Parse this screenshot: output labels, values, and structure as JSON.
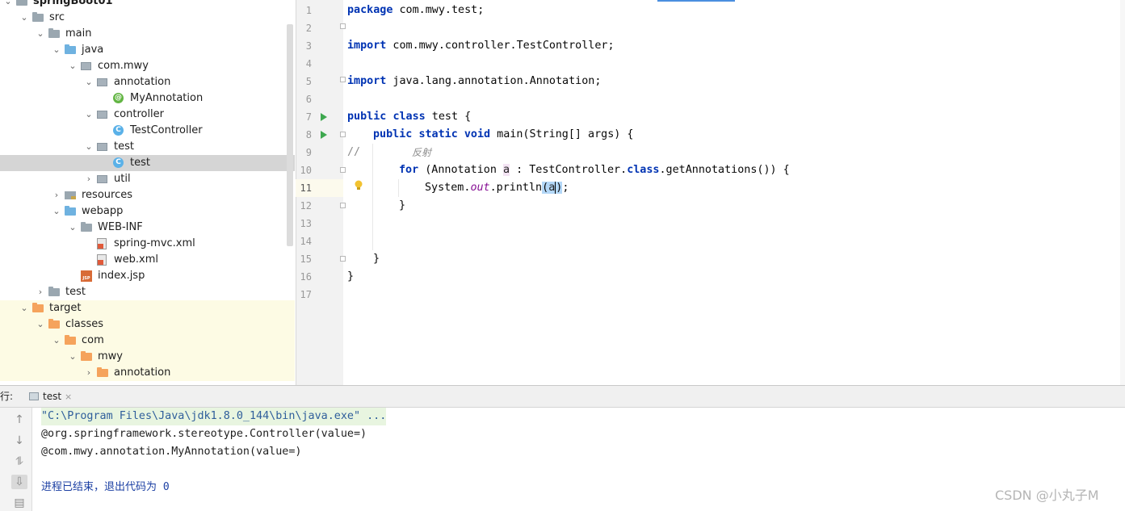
{
  "project_tree": {
    "items": [
      {
        "label": "springBoot01",
        "depth": 0,
        "icon": "module-icon",
        "expanded": true
      },
      {
        "label": "src",
        "depth": 1,
        "icon": "folder-icon",
        "expanded": true
      },
      {
        "label": "main",
        "depth": 2,
        "icon": "folder-icon",
        "expanded": true
      },
      {
        "label": "java",
        "depth": 3,
        "icon": "source-folder-icon",
        "expanded": true
      },
      {
        "label": "com.mwy",
        "depth": 4,
        "icon": "package-icon",
        "expanded": true
      },
      {
        "label": "annotation",
        "depth": 5,
        "icon": "package-icon",
        "expanded": true
      },
      {
        "label": "MyAnnotation",
        "depth": 6,
        "icon": "annotation-icon"
      },
      {
        "label": "controller",
        "depth": 5,
        "icon": "package-icon",
        "expanded": true
      },
      {
        "label": "TestController",
        "depth": 6,
        "icon": "class-icon"
      },
      {
        "label": "test",
        "depth": 5,
        "icon": "package-icon",
        "expanded": true
      },
      {
        "label": "test",
        "depth": 6,
        "icon": "class-icon",
        "selected": true
      },
      {
        "label": "util",
        "depth": 5,
        "icon": "package-icon",
        "expanded": false
      },
      {
        "label": "resources",
        "depth": 3,
        "icon": "resources-folder-icon",
        "expanded": false
      },
      {
        "label": "webapp",
        "depth": 3,
        "icon": "web-folder-icon",
        "expanded": true
      },
      {
        "label": "WEB-INF",
        "depth": 4,
        "icon": "folder-icon",
        "expanded": true
      },
      {
        "label": "spring-mvc.xml",
        "depth": 5,
        "icon": "xml-file-icon"
      },
      {
        "label": "web.xml",
        "depth": 5,
        "icon": "xml-file-icon"
      },
      {
        "label": "index.jsp",
        "depth": 4,
        "icon": "jsp-file-icon"
      },
      {
        "label": "test",
        "depth": 2,
        "icon": "folder-icon",
        "expanded": false
      },
      {
        "label": "target",
        "depth": 1,
        "icon": "excluded-folder-icon",
        "expanded": true,
        "excluded": true
      },
      {
        "label": "classes",
        "depth": 2,
        "icon": "excluded-folder-icon",
        "expanded": true,
        "excluded": true
      },
      {
        "label": "com",
        "depth": 3,
        "icon": "excluded-folder-icon",
        "expanded": true,
        "excluded": true
      },
      {
        "label": "mwy",
        "depth": 4,
        "icon": "excluded-folder-icon",
        "expanded": true,
        "excluded": true
      },
      {
        "label": "annotation",
        "depth": 5,
        "icon": "excluded-folder-icon",
        "expanded": false,
        "excluded": true
      }
    ]
  },
  "editor": {
    "line_numbers": [
      "1",
      "2",
      "3",
      "4",
      "5",
      "6",
      "7",
      "8",
      "9",
      "10",
      "11",
      "12",
      "13",
      "14",
      "15",
      "16",
      "17"
    ],
    "current_line": "11",
    "lines": {
      "l1": [
        "package com.mwy.test;"
      ],
      "l3": [
        "import com.mwy.controller.TestController;"
      ],
      "l5": [
        "import java.lang.annotation.Annotation;"
      ],
      "l7": [
        "public class test {"
      ],
      "l8": [
        "public static void main(String[] args) {"
      ],
      "l9": [
        "//",
        "反射"
      ],
      "l10": [
        "for (Annotation a : TestController.class.getAnnotations()) {"
      ],
      "l11": [
        "System.out.println(a);"
      ],
      "l12": [
        "}"
      ],
      "l15": [
        "}"
      ],
      "l16": [
        "}"
      ]
    },
    "tokens": {
      "l1_kw": "package",
      "l1_rest": " com.mwy.test;",
      "l3_kw": "import",
      "l3_rest": " com.mwy.controller.TestController;",
      "l5_kw": "import",
      "l5_rest": " java.lang.annotation.Annotation;",
      "l7_kw1": "public",
      "l7_kw2": "class",
      "l7_rest": " test {",
      "l8_kw1": "public",
      "l8_kw2": "static",
      "l8_kw3": "void",
      "l8_rest": " main(String[] args) {",
      "l9_slash": "//",
      "l9_text": "反射",
      "l10_kw": "for",
      "l10_a": " (Annotation ",
      "l10_var": "a",
      "l10_b": " : TestController.",
      "l10_kw2": "class",
      "l10_c": ".getAnnotations()) {",
      "l11_a": "System.",
      "l11_fld": "out",
      "l11_b": ".println",
      "l11_p1": "(",
      "l11_var": "a",
      "l11_p2": ")",
      "l11_end": ";",
      "l12": "}",
      "l15": "}",
      "l16": "}"
    }
  },
  "run_panel": {
    "label": "行:",
    "tab_label": "test",
    "tab_close": "×",
    "toolbar": [
      "up-arrow-icon",
      "down-arrow-icon",
      "soft-wrap-icon",
      "scroll-to-end-icon",
      "print-icon"
    ],
    "output": [
      "\"C:\\Program Files\\Java\\jdk1.8.0_144\\bin\\java.exe\" ...",
      "@org.springframework.stereotype.Controller(value=)",
      "@com.mwy.annotation.MyAnnotation(value=)",
      "",
      "进程已结束，退出代码为 0"
    ]
  },
  "watermark": "CSDN @小丸子M",
  "colors": {
    "keyword": "#0033b3",
    "comment": "#8c8c8c",
    "field": "#871094",
    "selection": "#d5d5d5",
    "excluded_bg": "#fdfbe4",
    "run_arrow": "#3ea84f"
  }
}
